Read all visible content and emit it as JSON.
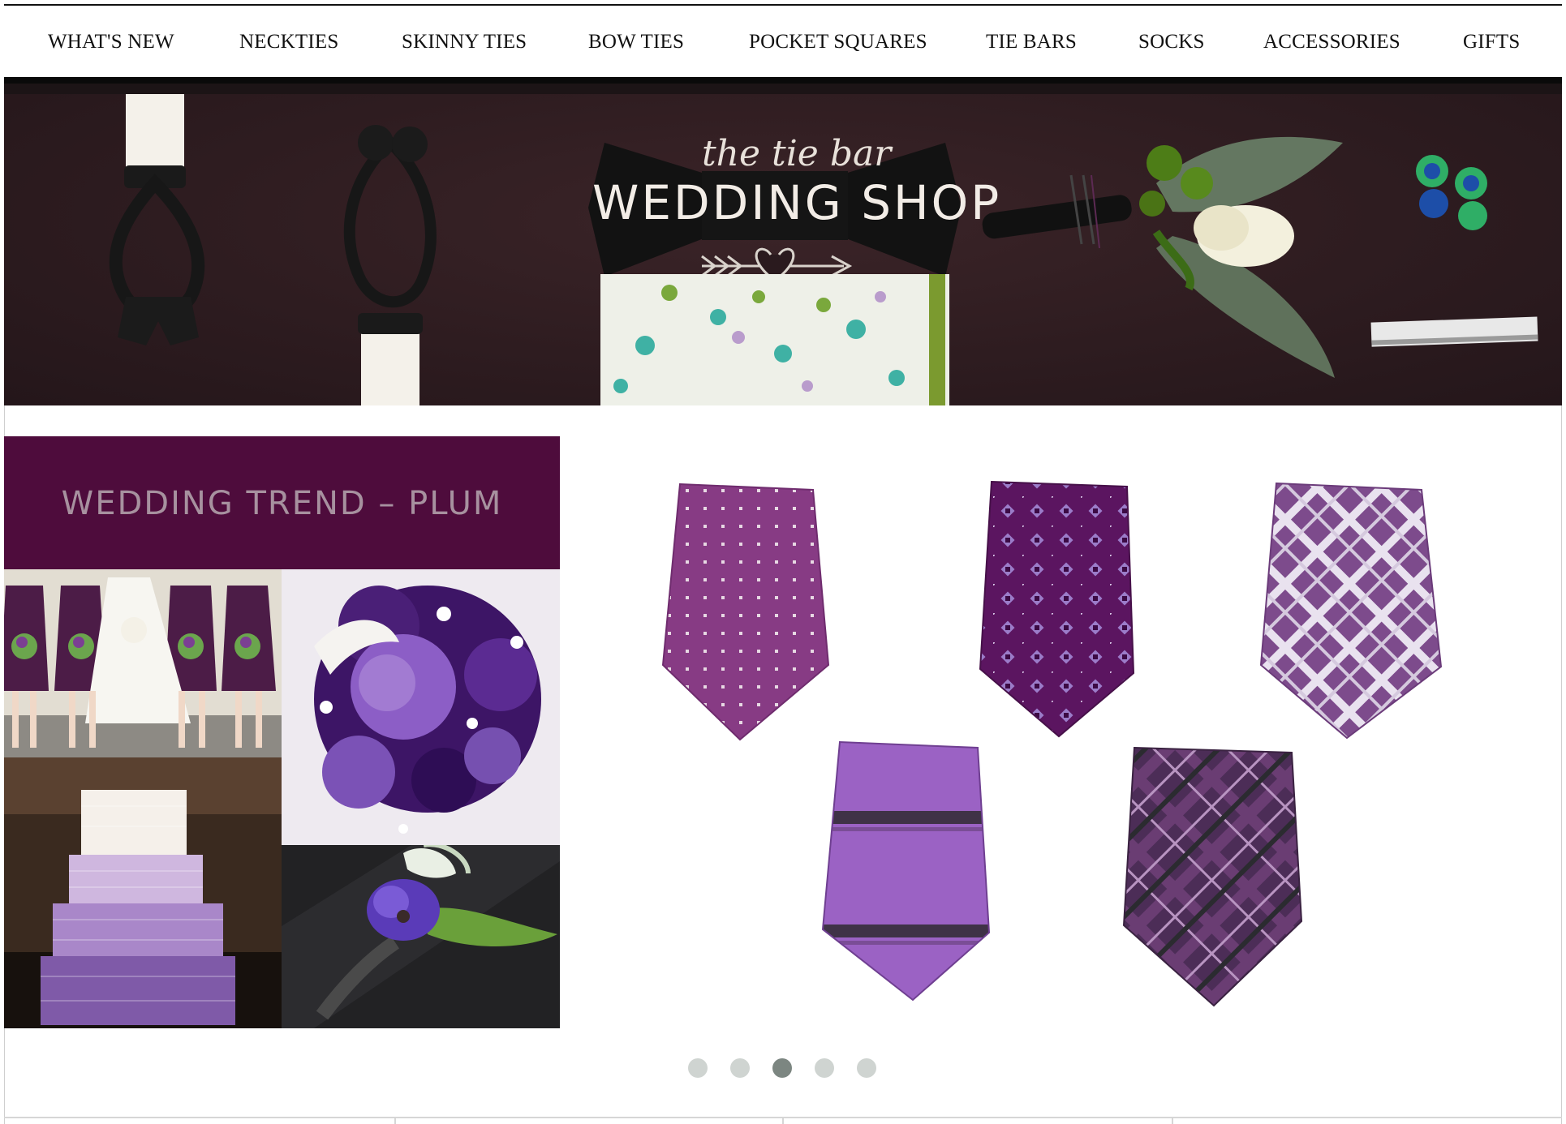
{
  "nav": {
    "items": [
      {
        "label": "WHAT'S NEW"
      },
      {
        "label": "NECKTIES"
      },
      {
        "label": "SKINNY TIES"
      },
      {
        "label": "BOW TIES"
      },
      {
        "label": "POCKET SQUARES"
      },
      {
        "label": "TIE BARS"
      },
      {
        "label": "SOCKS"
      },
      {
        "label": "ACCESSORIES"
      },
      {
        "label": "GIFTS"
      }
    ]
  },
  "hero": {
    "script_title": "the tie bar",
    "main_title": "WEDDING SHOP"
  },
  "promo": {
    "heading": "WEDDING TREND – PLUM",
    "brand_color": "#4e0c3c"
  },
  "carousel": {
    "slide_count": 5,
    "active_index": 2
  }
}
